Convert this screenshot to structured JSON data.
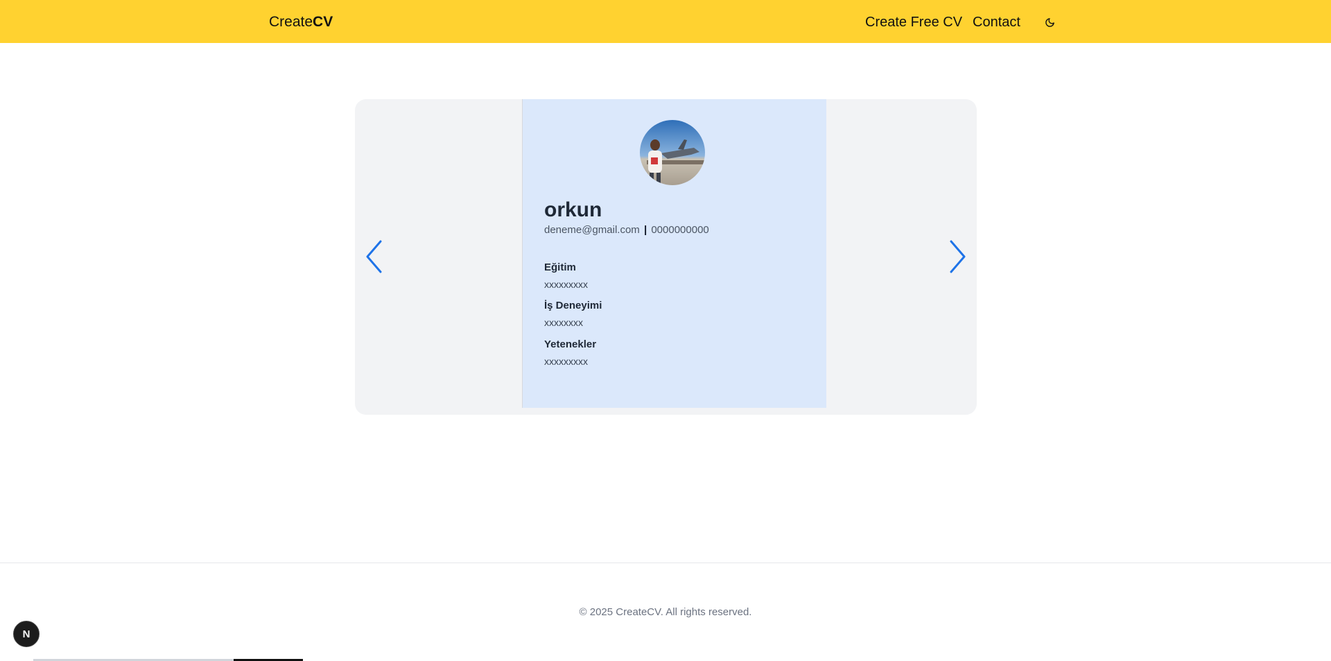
{
  "header": {
    "brand_prefix": "Create",
    "brand_bold": "CV",
    "nav_create": "Create Free CV",
    "nav_contact": "Contact",
    "theme_icon": "moon-icon",
    "background_color": "#ffd230"
  },
  "carousel": {
    "prev_icon": "chevron-left-icon",
    "next_icon": "chevron-right-icon",
    "arrow_color": "#1e73e8",
    "card": {
      "name": "orkun",
      "email": "deneme@gmail.com",
      "separator": "|",
      "phone": "0000000000",
      "sections": [
        {
          "title": "Eğitim",
          "value": "xxxxxxxxx"
        },
        {
          "title": "İş Deneyimi",
          "value": "xxxxxxxx"
        },
        {
          "title": "Yetenekler",
          "value": "xxxxxxxxx"
        }
      ],
      "background_color": "#dbe8fb"
    }
  },
  "footer": {
    "copyright": "© 2025 CreateCV. All rights reserved."
  },
  "dev_badge": {
    "label": "N"
  }
}
